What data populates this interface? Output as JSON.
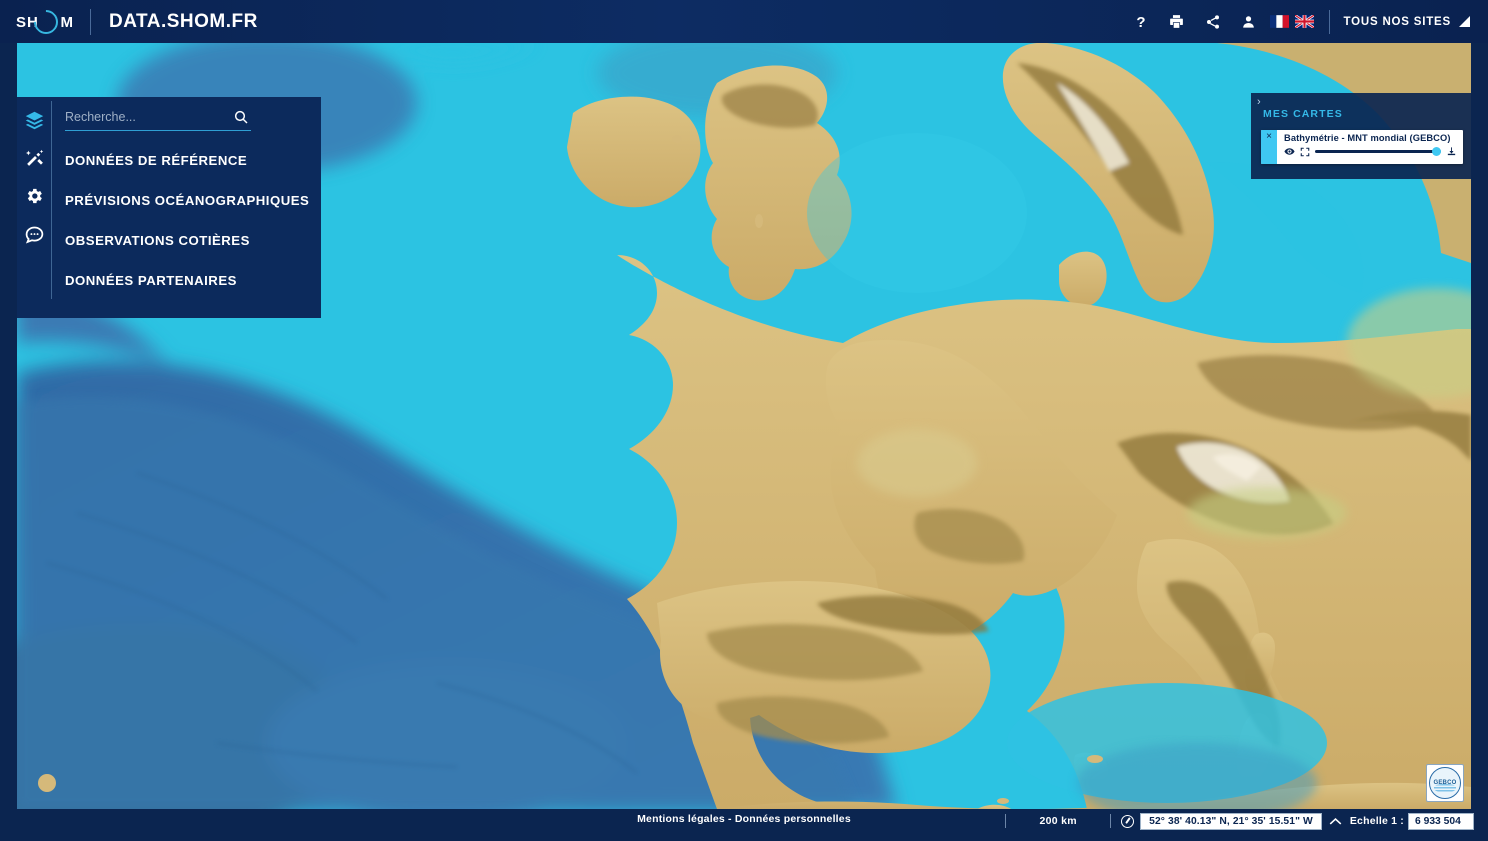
{
  "header": {
    "logo_left": "SH",
    "logo_right": "M",
    "logo_icon": "shom-ring-logo",
    "site_title": "DATA.SHOM.FR",
    "icons": [
      {
        "name": "help-icon",
        "glyph": "?"
      },
      {
        "name": "print-icon",
        "glyph": "printer"
      },
      {
        "name": "share-icon",
        "glyph": "share"
      },
      {
        "name": "user-account-icon",
        "glyph": "person"
      }
    ],
    "flags": [
      {
        "name": "flag-fr",
        "label": "Français"
      },
      {
        "name": "flag-en",
        "label": "English"
      }
    ],
    "all_sites_label": "TOUS NOS SITES"
  },
  "sidebar": {
    "tools": [
      {
        "name": "layers-icon",
        "label": "Couches",
        "active": true
      },
      {
        "name": "tools-wand-icon",
        "label": "Outils",
        "active": false
      },
      {
        "name": "gear-icon",
        "label": "Paramètres",
        "active": false
      },
      {
        "name": "chat-bubble-icon",
        "label": "Contact",
        "active": false
      }
    ],
    "search": {
      "placeholder": "Recherche...",
      "value": ""
    },
    "menu": [
      {
        "label": "DONNÉES DE RÉFÉRENCE"
      },
      {
        "label": "PRÉVISIONS OCÉANOGRAPHIQUES"
      },
      {
        "label": "OBSERVATIONS COTIÈRES"
      },
      {
        "label": "DONNÉES PARTENAIRES"
      }
    ]
  },
  "mes_cartes": {
    "chevron": "›",
    "title": "MES CARTES",
    "layers": [
      {
        "close": "×",
        "name": "Bathymétrie - MNT mondial (GEBCO)",
        "opacity": 100,
        "visible": true
      }
    ]
  },
  "map": {
    "attribution_logo": "GEBCO",
    "colors": {
      "shelf_cyan": "#2cc3e2",
      "deep_blue": "#3a7ab4",
      "deeper_blue": "#2f6ba6",
      "land_tan": "#d9bd7d",
      "land_dark": "#9c8246",
      "snow": "#f2f2ee",
      "lowland_green": "#c6cf83"
    }
  },
  "footer": {
    "legal": "Mentions légales - Données personnelles",
    "scale_bar_label": "200 km",
    "compass_icon": "compass-icon",
    "coordinates": "52° 38' 40.13\" N, 21° 35' 15.51\" W",
    "collapse_icon": "chevron-up-icon",
    "scale_label": "Echelle 1 :",
    "scale_value": "6 933 504"
  }
}
